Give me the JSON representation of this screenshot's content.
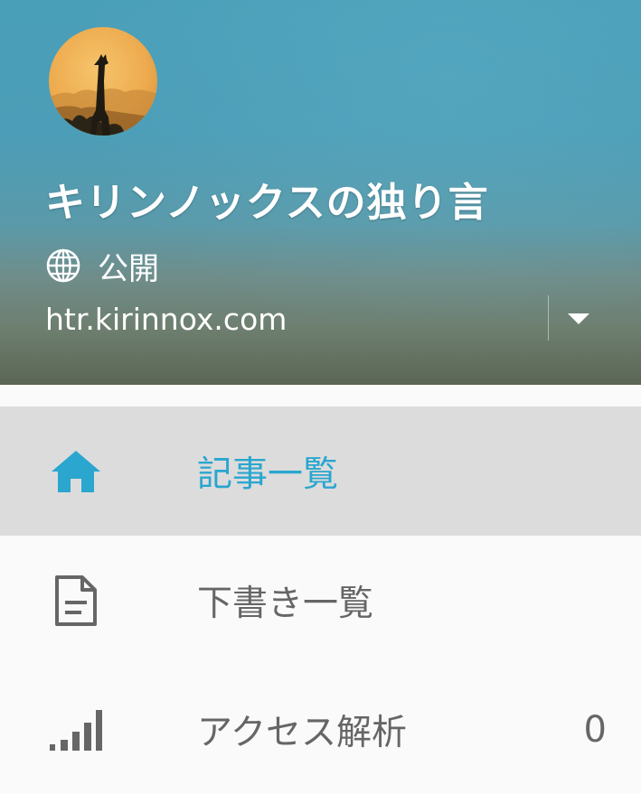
{
  "header": {
    "blog_title": "キリンノックスの独り言",
    "visibility_label": "公開",
    "blog_url": "htr.kirinnox.com",
    "avatar_icon": "giraffe-silhouette-sunset",
    "dropdown_icon": "caret-down-icon"
  },
  "nav": {
    "items": [
      {
        "label": "記事一覧",
        "icon": "home-icon",
        "active": true
      },
      {
        "label": "下書き一覧",
        "icon": "document-icon",
        "active": false
      },
      {
        "label": "アクセス解析",
        "icon": "signal-bars-icon",
        "active": false,
        "count": "0"
      }
    ]
  },
  "colors": {
    "accent": "#2aa6cf",
    "active_background": "#dcdcdc",
    "inactive_text": "#666666",
    "page_background": "#fafafa"
  }
}
